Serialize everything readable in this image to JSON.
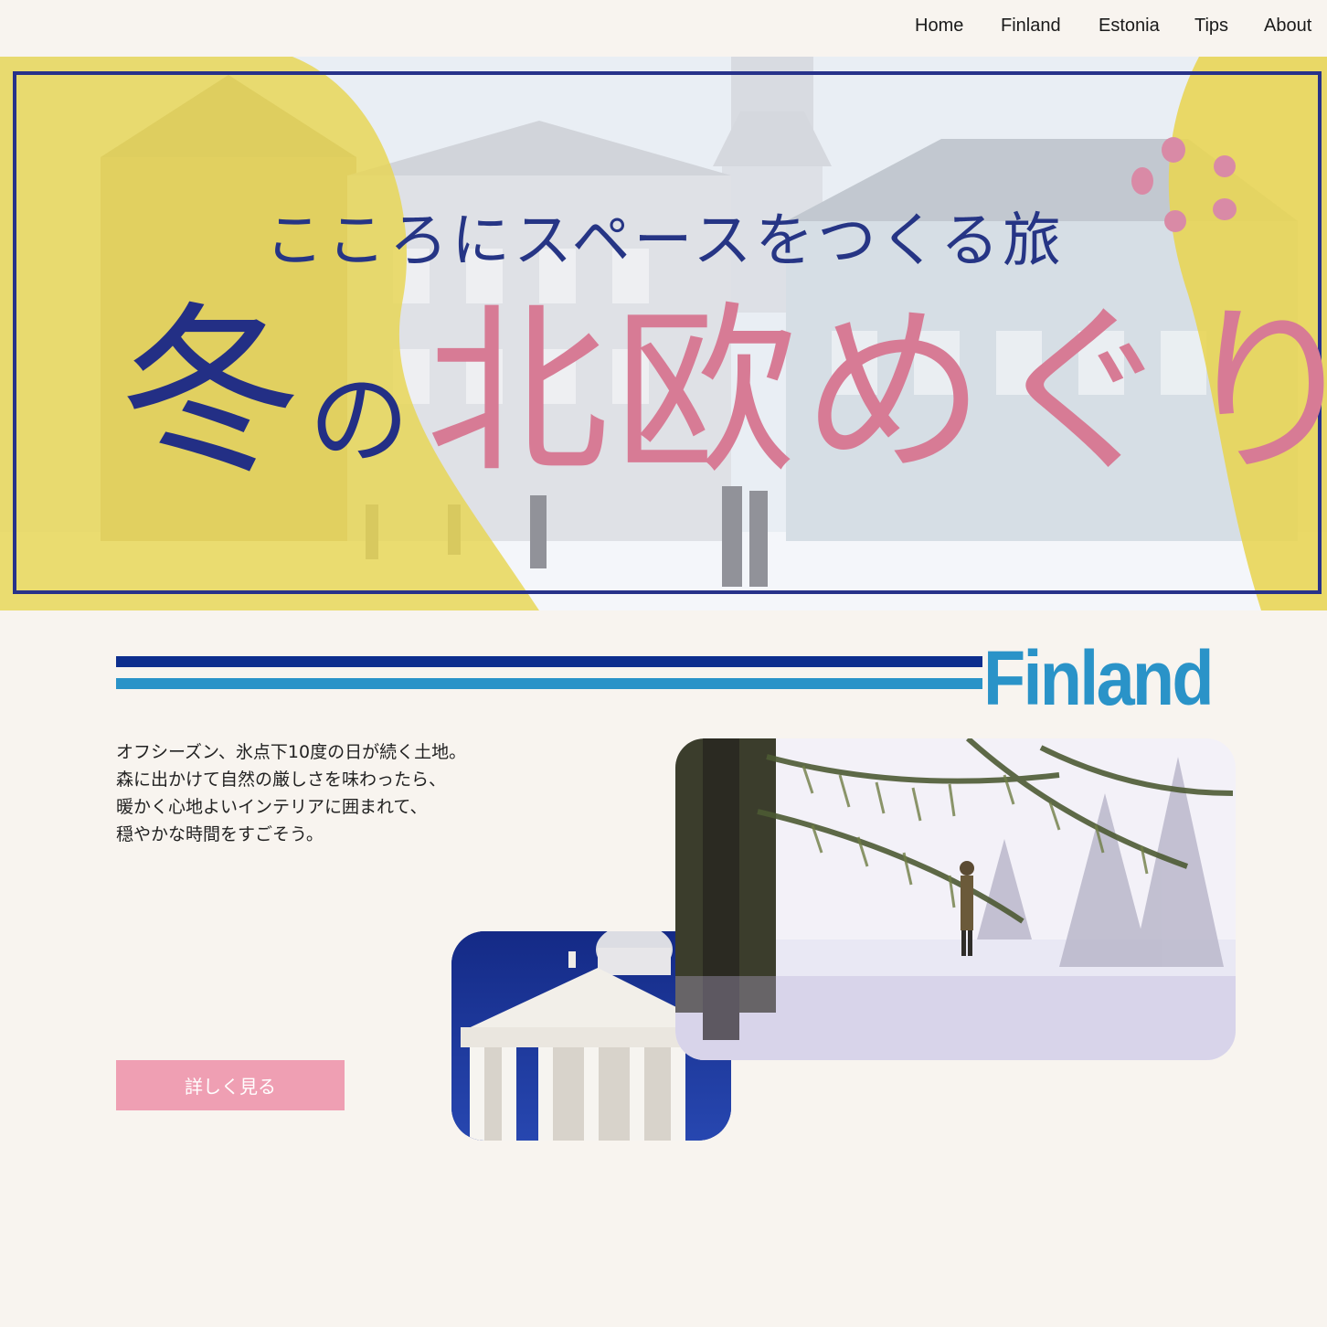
{
  "nav": {
    "items": [
      {
        "label": "Home"
      },
      {
        "label": "Finland"
      },
      {
        "label": "Estonia"
      },
      {
        "label": "Tips"
      },
      {
        "label": "About"
      }
    ]
  },
  "hero": {
    "subtitle": "こころにスペースをつくる旅",
    "title_part1": "冬",
    "title_part2": "の",
    "title_part3": "北欧めぐり"
  },
  "section": {
    "title": "Finland",
    "description": [
      "オフシーズン、氷点下10度の日が続く土地。",
      "森に出かけて自然の厳しさを味わったら、",
      "暖かく心地よいインテリアに囲まれて、",
      "穏やかな時間をすごそう。"
    ],
    "button_label": "詳しく見る"
  },
  "colors": {
    "navy": "#263585",
    "pink": "#d77b95",
    "yellow": "#e8d552",
    "blue": "#2a93c8",
    "dark_blue": "#0d2e8e",
    "button": "#ef9fb3",
    "background": "#f8f4ef"
  }
}
